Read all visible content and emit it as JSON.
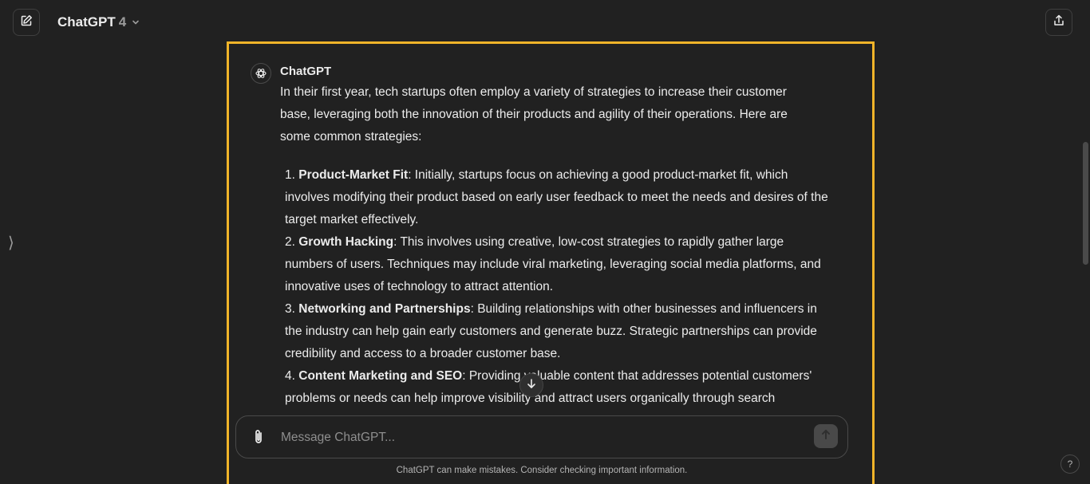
{
  "header": {
    "model_name": "ChatGPT",
    "model_version": "4",
    "new_chat_icon": "pencil-square-icon",
    "share_icon": "share-icon"
  },
  "sidebar": {
    "toggle_glyph": "⟩"
  },
  "message": {
    "sender": "ChatGPT",
    "intro": "In their first year, tech startups often employ a variety of strategies to increase their customer base, leveraging both the innovation of their products and agility of their operations. Here are some common strategies:",
    "items": [
      {
        "number": "1.",
        "title": "Product-Market Fit",
        "text": ": Initially, startups focus on achieving a good product-market fit, which involves modifying their product based on early user feedback to meet the needs and desires of the target market effectively."
      },
      {
        "number": "2.",
        "title": "Growth Hacking",
        "text": ": This involves using creative, low-cost strategies to rapidly gather large numbers of users. Techniques may include viral marketing, leveraging social media platforms, and innovative uses of technology to attract attention."
      },
      {
        "number": "3.",
        "title": "Networking and Partnerships",
        "text": ": Building relationships with other businesses and influencers in the industry can help gain early customers and generate buzz. Strategic partnerships can provide credibility and access to a broader customer base."
      },
      {
        "number": "4.",
        "title": "Content Marketing and SEO",
        "text": ": Providing valuable content that addresses potential customers' problems or needs can help improve visibility and attract users organically through search"
      }
    ]
  },
  "composer": {
    "placeholder": "Message ChatGPT...",
    "value": ""
  },
  "disclaimer": "ChatGPT can make mistakes. Consider checking important information.",
  "help_label": "?",
  "colors": {
    "background": "#212121",
    "highlight_frame": "#f0b429",
    "text": "#ececec",
    "muted": "#9b9b9b"
  }
}
